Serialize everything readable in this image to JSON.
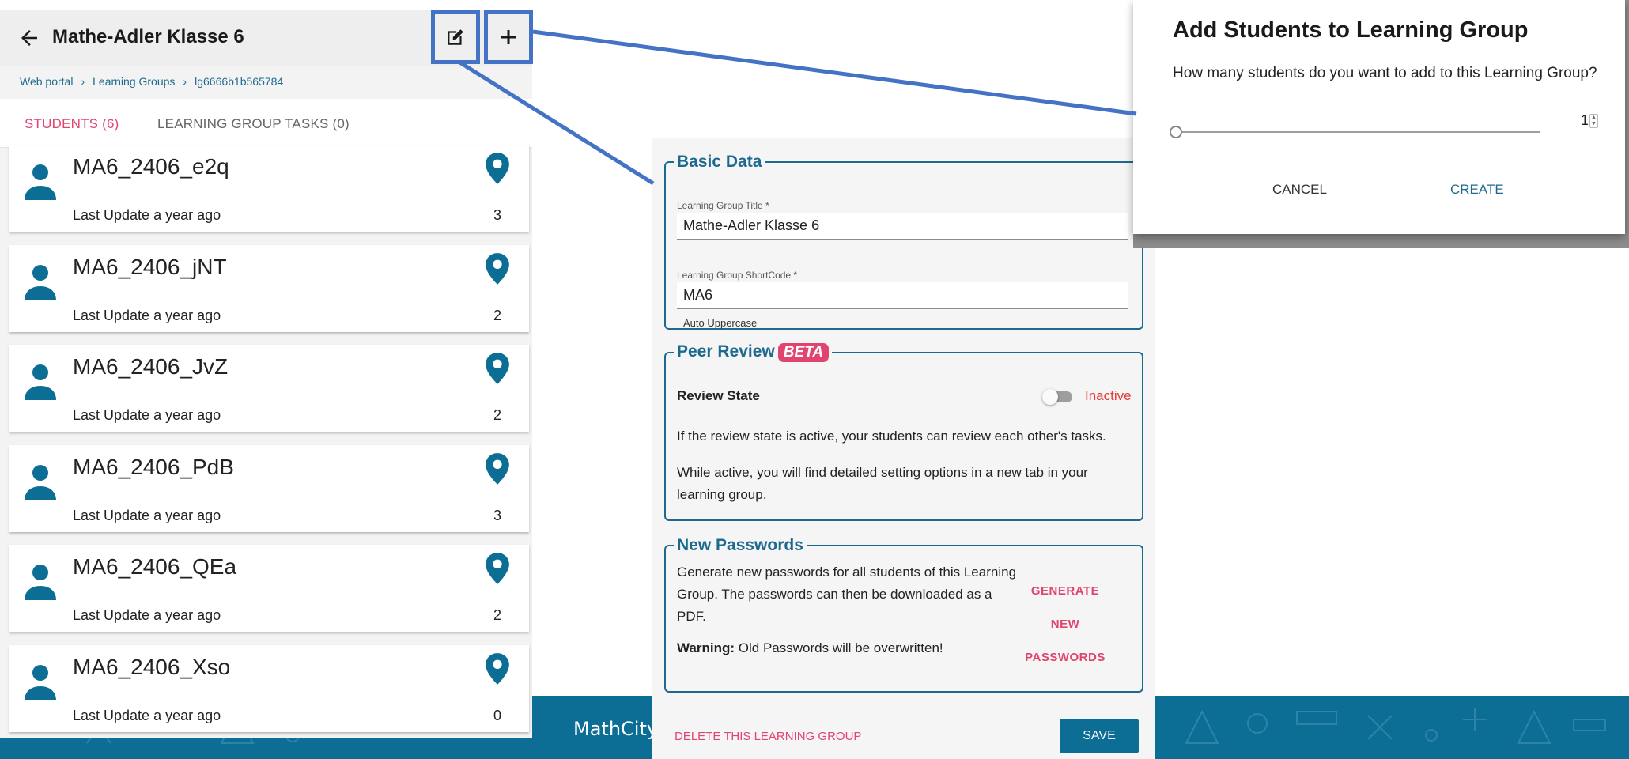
{
  "footer": {
    "brand_text": "MathCity"
  },
  "header": {
    "title": "Mathe-Adler Klasse 6"
  },
  "breadcrumb": {
    "items": [
      "Web portal",
      "Learning Groups",
      "lg6666b1b565784"
    ],
    "separator": "›"
  },
  "tabs": [
    {
      "label": "STUDENTS (6)",
      "active": true
    },
    {
      "label": "LEARNING GROUP TASKS (0)",
      "active": false
    }
  ],
  "students": [
    {
      "name": "MA6_2406_e2q",
      "updated": "Last Update a year ago",
      "count": "3"
    },
    {
      "name": "MA6_2406_jNT",
      "updated": "Last Update a year ago",
      "count": "2"
    },
    {
      "name": "MA6_2406_JvZ",
      "updated": "Last Update a year ago",
      "count": "2"
    },
    {
      "name": "MA6_2406_PdB",
      "updated": "Last Update a year ago",
      "count": "3"
    },
    {
      "name": "MA6_2406_QEa",
      "updated": "Last Update a year ago",
      "count": "2"
    },
    {
      "name": "MA6_2406_Xso",
      "updated": "Last Update a year ago",
      "count": "0"
    }
  ],
  "form": {
    "basic": {
      "legend": "Basic Data",
      "title_label": "Learning Group Title *",
      "title_value": "Mathe-Adler Klasse 6",
      "code_label": "Learning Group ShortCode *",
      "code_value": "MA6",
      "code_hint": "Auto Uppercase"
    },
    "peer": {
      "legend": "Peer Review",
      "badge": "BETA",
      "state_label": "Review State",
      "state_value": "Inactive",
      "text1": "If the review state is active, your students can review each other's tasks.",
      "text2": "While active, you will find detailed setting options in a new tab in your learning group."
    },
    "passwords": {
      "legend": "New Passwords",
      "text": "Generate new passwords for all students of this Learning Group. The passwords can then be downloaded as a PDF.",
      "warning_bold": "Warning:",
      "warning_text": "Old Passwords will be overwritten!",
      "button_lines": [
        "GENERATE",
        "NEW",
        "PASSWORDS"
      ]
    },
    "delete_label": "DELETE THIS LEARNING GROUP",
    "save_label": "SAVE"
  },
  "dialog": {
    "title": "Add Students to Learning Group",
    "question": "How many students do you want to add to this Learning Group?",
    "value": "1",
    "cancel_label": "CANCEL",
    "create_label": "CREATE"
  },
  "colors": {
    "accent": "#1e6a8f",
    "pink": "#e0446f",
    "highlight": "#4472c4",
    "footer": "#0d6e95"
  }
}
